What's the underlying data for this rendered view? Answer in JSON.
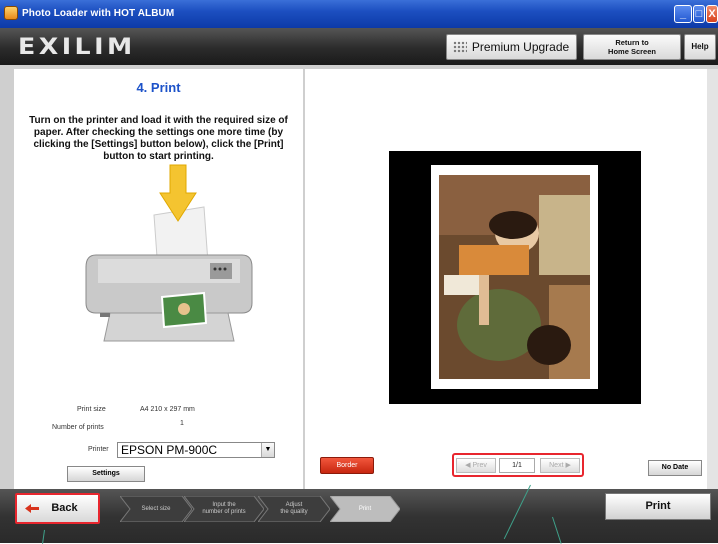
{
  "window": {
    "title": "Photo Loader with HOT ALBUM",
    "controls": {
      "minimize": "_",
      "maximize": "□",
      "close": "X"
    }
  },
  "header": {
    "logo": "EXILIM",
    "premium_upgrade": "Premium Upgrade",
    "return_home_line1": "Return to",
    "return_home_line2": "Home Screen",
    "help": "Help"
  },
  "step_title": "4. Print",
  "instructions": "Turn on the printer and load it with the required size of paper. After checking the settings one more time (by clicking the [Settings] button below), click the [Print] button to start printing.",
  "settings": {
    "print_size_label": "Print size",
    "print_size_value": "A4 210 x 297 mm",
    "number_of_prints_label": "Number of prints",
    "number_of_prints_value": "1",
    "printer_label": "Printer",
    "printer_value": "EPSON PM-900C",
    "settings_button": "Settings"
  },
  "preview": {
    "border_button": "Border",
    "prev": "Prev",
    "next": "Next",
    "page_indicator": "1/1",
    "no_date_button": "No Date"
  },
  "bottom": {
    "back": "Back",
    "steps": [
      {
        "line1": "Select size",
        "line2": ""
      },
      {
        "line1": "Input the",
        "line2": "number of prints"
      },
      {
        "line1": "Adjust",
        "line2": "the quality"
      },
      {
        "line1": "Print",
        "line2": ""
      }
    ],
    "print": "Print"
  },
  "colors": {
    "accent_blue": "#1c52c9",
    "highlight_red": "#e8262e",
    "border_button_red": "#d8331c",
    "titlebar_blue": "#1c4fc0",
    "header_dark": "#2b2b2b"
  }
}
